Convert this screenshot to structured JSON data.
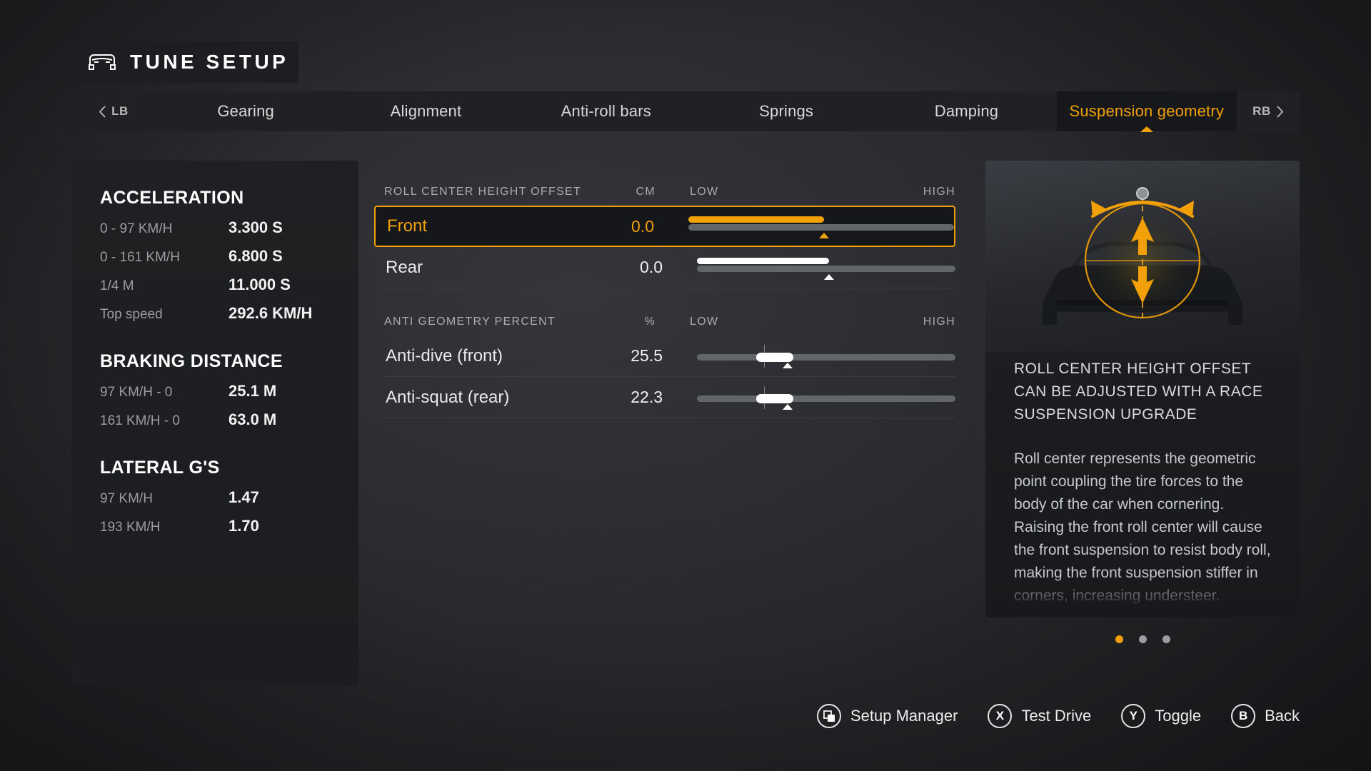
{
  "header": {
    "title": "TUNE SETUP",
    "car_icon": "car-front-icon"
  },
  "tabs": {
    "prev_hint": "LB",
    "next_hint": "RB",
    "items": [
      {
        "label": "Gearing",
        "active": false
      },
      {
        "label": "Alignment",
        "active": false
      },
      {
        "label": "Anti-roll bars",
        "active": false
      },
      {
        "label": "Springs",
        "active": false
      },
      {
        "label": "Damping",
        "active": false
      },
      {
        "label": "Suspension geometry",
        "active": true
      }
    ]
  },
  "stats": {
    "sections": [
      {
        "heading": "ACCELERATION",
        "rows": [
          {
            "label": "0 - 97 KM/H",
            "value": "3.300 S"
          },
          {
            "label": "0 - 161 KM/H",
            "value": "6.800 S"
          },
          {
            "label": "1/4 M",
            "value": "11.000 S"
          },
          {
            "label": "Top speed",
            "value": "292.6 KM/H"
          }
        ]
      },
      {
        "heading": "BRAKING DISTANCE",
        "rows": [
          {
            "label": "97 KM/H - 0",
            "value": "25.1 M"
          },
          {
            "label": "161 KM/H - 0",
            "value": "63.0 M"
          }
        ]
      },
      {
        "heading": "LATERAL G'S",
        "rows": [
          {
            "label": "97 KM/H",
            "value": "1.47"
          },
          {
            "label": "193 KM/H",
            "value": "1.70"
          }
        ]
      }
    ]
  },
  "settings": {
    "groups": [
      {
        "title": "ROLL CENTER HEIGHT OFFSET",
        "unit": "CM",
        "low": "LOW",
        "high": "HIGH",
        "rows": [
          {
            "name": "Front",
            "value": "0.0",
            "fill_pct": 51,
            "selected": true,
            "style": "fill"
          },
          {
            "name": "Rear",
            "value": "0.0",
            "fill_pct": 51,
            "selected": false,
            "style": "fill"
          }
        ]
      },
      {
        "title": "ANTI GEOMETRY PERCENT",
        "unit": "%",
        "low": "LOW",
        "high": "HIGH",
        "rows": [
          {
            "name": "Anti-dive (front)",
            "value": "25.5",
            "fill_pct": 26,
            "selected": false,
            "style": "pill"
          },
          {
            "name": "Anti-squat (rear)",
            "value": "22.3",
            "fill_pct": 26,
            "selected": false,
            "style": "pill"
          }
        ]
      }
    ]
  },
  "info": {
    "illustration": "car-roll-center-diagram",
    "title": "ROLL CENTER HEIGHT OFFSET CAN BE ADJUSTED WITH A RACE SUSPENSION UPGRADE",
    "body": "Roll center represents the geometric point coupling the tire forces to the body of the car when cornering. Raising the front roll center will cause the front suspension to resist body roll, making the front suspension stiffer in corners, increasing understeer. Raising it too high",
    "page_dots": 3,
    "active_dot": 0
  },
  "footer": {
    "buttons": [
      {
        "glyph": "⧉",
        "icon_name": "setup-manager-icon",
        "label": "Setup Manager"
      },
      {
        "glyph": "X",
        "icon_name": "button-x-icon",
        "label": "Test Drive"
      },
      {
        "glyph": "Y",
        "icon_name": "button-y-icon",
        "label": "Toggle"
      },
      {
        "glyph": "B",
        "icon_name": "button-b-icon",
        "label": "Back"
      }
    ]
  },
  "colors": {
    "accent": "#f2a007",
    "panel": "#1e2023",
    "text": "#e8e8e8"
  }
}
